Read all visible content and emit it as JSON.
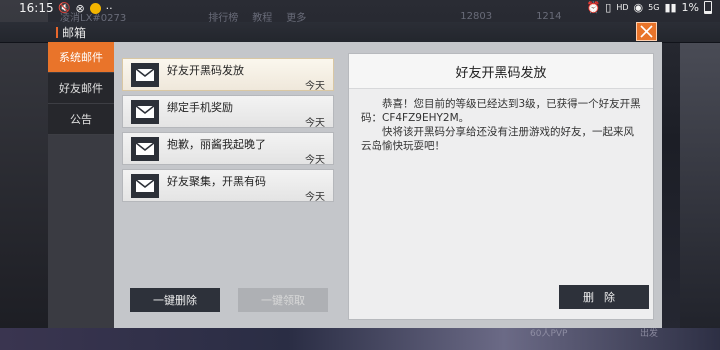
{
  "status": {
    "time": "16:15",
    "battery": "1%",
    "net": "HD",
    "net2": "5G"
  },
  "game": {
    "player": "凌消LX#0273",
    "menu": [
      "排行榜",
      "教程",
      "更多"
    ],
    "currency1": "12803",
    "currency2": "1214",
    "bottom_label": "60人PVP",
    "bottom_label2": "出发"
  },
  "window": {
    "title": "邮箱"
  },
  "sidebar": {
    "items": [
      {
        "label": "系统邮件",
        "active": true
      },
      {
        "label": "好友邮件",
        "active": false
      },
      {
        "label": "公告",
        "active": false
      }
    ]
  },
  "mails": [
    {
      "title": "好友开黑码发放",
      "date": "今天",
      "selected": true
    },
    {
      "title": "绑定手机奖励",
      "date": "今天",
      "selected": false
    },
    {
      "title": "抱歉，丽酱我起晚了",
      "date": "今天",
      "selected": false
    },
    {
      "title": "好友聚集，开黑有码",
      "date": "今天",
      "selected": false
    }
  ],
  "buttons": {
    "delete_all": "一键删除",
    "collect_all": "一键领取",
    "delete": "删除"
  },
  "detail": {
    "title": "好友开黑码发放",
    "para1": "恭喜！您目前的等级已经达到3级，已获得一个好友开黑码：CF4FZ9EHY2M。",
    "para2": "快将该开黑码分享给还没有注册游戏的好友，一起来风云岛愉快玩耍吧！"
  },
  "colors": {
    "accent": "#e9742a",
    "dark_button": "#2d313a"
  }
}
